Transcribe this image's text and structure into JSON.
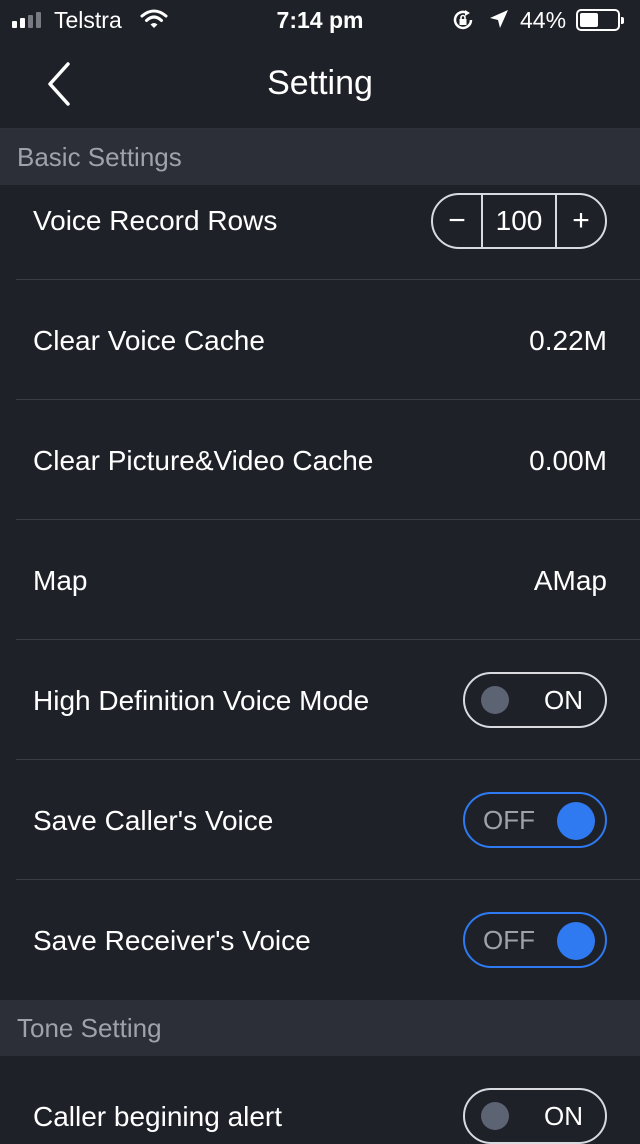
{
  "status_bar": {
    "carrier": "Telstra",
    "time": "7:14 pm",
    "battery": "44%",
    "icons": [
      "signal-icon",
      "wifi-icon",
      "rotation-lock-icon",
      "location-arrow-icon",
      "battery-icon"
    ]
  },
  "nav": {
    "title": "Setting",
    "back_icon": "chevron-left-icon"
  },
  "sections": [
    {
      "header": "Basic Settings",
      "rows": [
        {
          "label": "Voice Record Rows",
          "control": "stepper",
          "minus": "−",
          "value": "100",
          "plus": "+"
        },
        {
          "label": "Clear Voice Cache",
          "control": "value",
          "value": "0.22M"
        },
        {
          "label": "Clear Picture&Video Cache",
          "control": "value",
          "value": "0.00M"
        },
        {
          "label": "Map",
          "control": "value",
          "value": "AMap"
        },
        {
          "label": "High Definition Voice Mode",
          "control": "toggle",
          "value": "ON"
        },
        {
          "label": "Save Caller's Voice",
          "control": "toggle",
          "value": "OFF"
        },
        {
          "label": "Save Receiver's Voice",
          "control": "toggle",
          "value": "OFF"
        }
      ]
    },
    {
      "header": "Tone Setting",
      "rows": [
        {
          "label": "Caller begining alert",
          "control": "toggle",
          "value": "ON"
        }
      ]
    }
  ],
  "colors": {
    "background": "#1e2128",
    "section_header_bg": "#2c2f37",
    "accent_blue": "#2f7af0",
    "divider": "#3a3d45"
  }
}
